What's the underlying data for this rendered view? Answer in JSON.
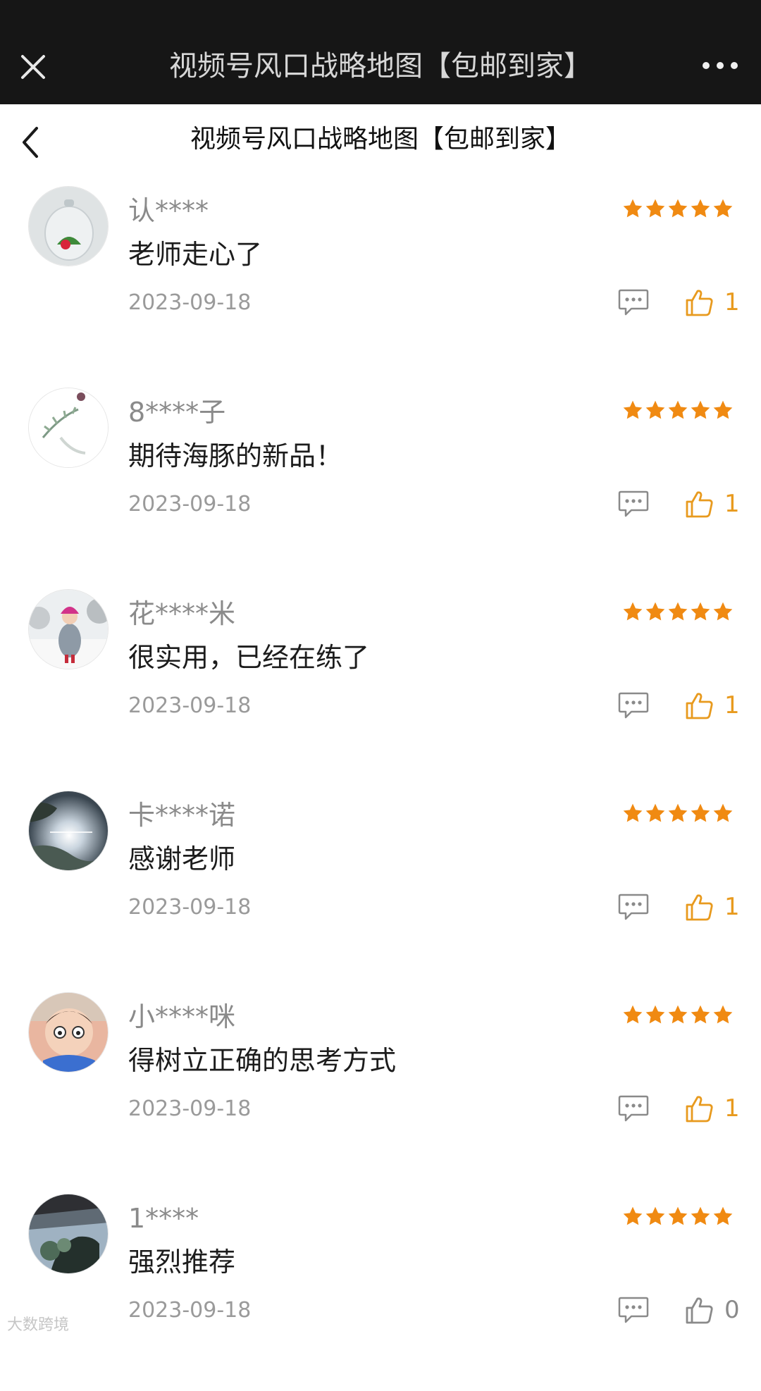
{
  "window": {
    "title": "视频号风口战略地图【包邮到家】"
  },
  "header": {
    "title": "视频号风口战略地图【包邮到家】"
  },
  "colors": {
    "topbar_bg": "#161616",
    "star": "#f08a12",
    "like_active": "#e89a1e",
    "username": "#8a8a8a",
    "date": "#9a9a9a"
  },
  "icons": {
    "close": "close-icon",
    "more": "more-icon",
    "back": "back-chevron-icon",
    "star": "star-icon",
    "reply": "comment-bubble-icon",
    "like": "thumbs-up-icon"
  },
  "reviews": [
    {
      "user": "认****",
      "rating": 5,
      "comment": "老师走心了",
      "date": "2023-09-18",
      "likes": "1"
    },
    {
      "user": "8****子",
      "rating": 5,
      "comment": "期待海豚的新品！",
      "date": "2023-09-18",
      "likes": "1"
    },
    {
      "user": "花****米",
      "rating": 5,
      "comment": "很实用，已经在练了",
      "date": "2023-09-18",
      "likes": "1"
    },
    {
      "user": "卡****诺",
      "rating": 5,
      "comment": "感谢老师",
      "date": "2023-09-18",
      "likes": "1"
    },
    {
      "user": "小****咪",
      "rating": 5,
      "comment": "得树立正确的思考方式",
      "date": "2023-09-18",
      "likes": "1"
    },
    {
      "user": "1****",
      "rating": 5,
      "comment": "强烈推荐",
      "date": "2023-09-18",
      "likes": "0"
    }
  ],
  "watermark": "大数跨境"
}
